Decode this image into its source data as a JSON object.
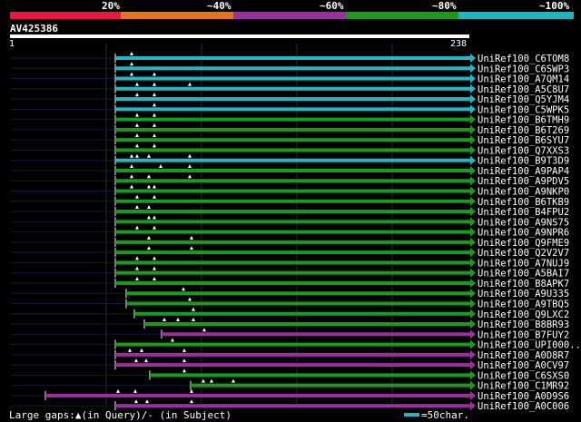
{
  "legend": {
    "labels": [
      "20%",
      "~40%",
      "~60%",
      "~80%",
      "~100%"
    ],
    "segment_colors": [
      "#e8173c",
      "#e8731e",
      "#9b2fa0",
      "#1a9c1a",
      "#1ab7c0"
    ]
  },
  "query": {
    "id": "AV425386",
    "start": "1",
    "end": "238"
  },
  "colors": {
    "cyan": "#1fb8c4",
    "green": "#1a9c1a",
    "purple": "#9b2fa0",
    "gap_line": "#101a40",
    "grid": "#2a2a2a",
    "ruler": "#ffffff"
  },
  "hits": [
    {
      "name": "UniRef100_C6TOM8",
      "identity": "~100%"
    },
    {
      "name": "UniRef100_C6SWP3",
      "identity": "~100%"
    },
    {
      "name": "UniRef100_A7QM14",
      "identity": "~100%"
    },
    {
      "name": "UniRef100_A5C8U7",
      "identity": "~100%"
    },
    {
      "name": "UniRef100_Q5YJM4",
      "identity": "~100%"
    },
    {
      "name": "UniRef100_C5WPK5",
      "identity": "~100%"
    },
    {
      "name": "UniRef100_B6TMH9",
      "identity": "~80%"
    },
    {
      "name": "UniRef100_B6T269",
      "identity": "~80%"
    },
    {
      "name": "UniRef100_B6SYU7",
      "identity": "~80%"
    },
    {
      "name": "UniRef100_Q7XXS3",
      "identity": "~80%"
    },
    {
      "name": "UniRef100_B9T3D9",
      "identity": "~100%"
    },
    {
      "name": "UniRef100_A9PAP4",
      "identity": "~80%"
    },
    {
      "name": "UniRef100_A9PDV5",
      "identity": "~80%"
    },
    {
      "name": "UniRef100_A9NKP0",
      "identity": "~80%"
    },
    {
      "name": "UniRef100_B6TKB9",
      "identity": "~80%"
    },
    {
      "name": "UniRef100_B4FPU2",
      "identity": "~80%"
    },
    {
      "name": "UniRef100_A9NS75",
      "identity": "~80%"
    },
    {
      "name": "UniRef100_A9NPR6",
      "identity": "~80%"
    },
    {
      "name": "UniRef100_Q9FME9",
      "identity": "~80%"
    },
    {
      "name": "UniRef100_Q2V2V7",
      "identity": "~80%"
    },
    {
      "name": "UniRef100_A7NUJ9",
      "identity": "~80%"
    },
    {
      "name": "UniRef100_A5BAI7",
      "identity": "~80%"
    },
    {
      "name": "UniRef100_B8APK7",
      "identity": "~80%"
    },
    {
      "name": "UniRef100_A9U335",
      "identity": "~80%"
    },
    {
      "name": "UniRef100_A9TBQ5",
      "identity": "~80%"
    },
    {
      "name": "UniRef100_Q9LXC2",
      "identity": "~80%"
    },
    {
      "name": "UniRef100_B8BR93",
      "identity": "~80%"
    },
    {
      "name": "UniRef100_B7FUY2",
      "identity": "~60%"
    },
    {
      "name": "UniRef100_UPI000..",
      "identity": "~80%"
    },
    {
      "name": "UniRef100_A0D8R7",
      "identity": "~60%"
    },
    {
      "name": "UniRef100_A0CV97",
      "identity": "~60%"
    },
    {
      "name": "UniRef100_C6SXS0",
      "identity": "~80%"
    },
    {
      "name": "UniRef100_C1MR92",
      "identity": "~80%"
    },
    {
      "name": "UniRef100_A0D9S6",
      "identity": "~60%"
    },
    {
      "name": "UniRef100_A0C006",
      "identity": "~60%"
    }
  ],
  "footer": {
    "gap_legend": "Large gaps:▲(in Query)/- (in Subject)",
    "scale_label": "=50char."
  }
}
